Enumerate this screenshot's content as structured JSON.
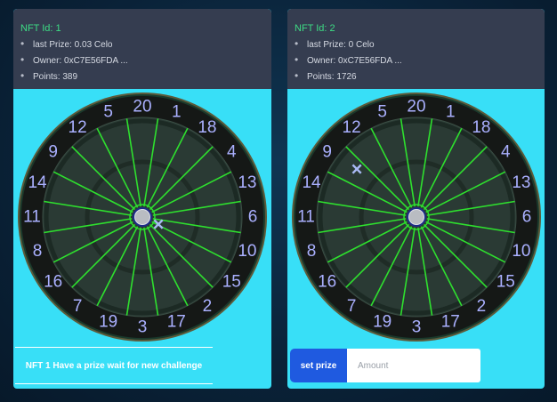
{
  "cards": [
    {
      "nft_id": "NFT Id: 1",
      "last_prize": "last Prize: 0.03 Celo",
      "owner": "Owner: 0xC7E56FDA ...",
      "points": "Points: 389",
      "marker_symbol": "×",
      "message": "NFT 1 Have a prize wait for new challenge"
    },
    {
      "nft_id": "NFT Id: 2",
      "last_prize": "last Prize: 0 Celo",
      "owner": "Owner: 0xC7E56FDA ...",
      "points": "Points: 1726",
      "marker_symbol": "×",
      "set_prize_label": "set prize",
      "amount_placeholder": "Amount"
    }
  ],
  "dartboard": {
    "numbers": [
      "20",
      "1",
      "18",
      "4",
      "13",
      "6",
      "10",
      "15",
      "2",
      "17",
      "3",
      "19",
      "7",
      "16",
      "8",
      "11",
      "14",
      "9",
      "12",
      "5"
    ]
  },
  "colors": {
    "card_bg": "#38dff7",
    "header_bg": "#353d50",
    "nft_id": "#3ddc84",
    "wire": "#2ee02e",
    "numbers": "#aab0ff",
    "set_prize_button": "#1f5ae0"
  }
}
